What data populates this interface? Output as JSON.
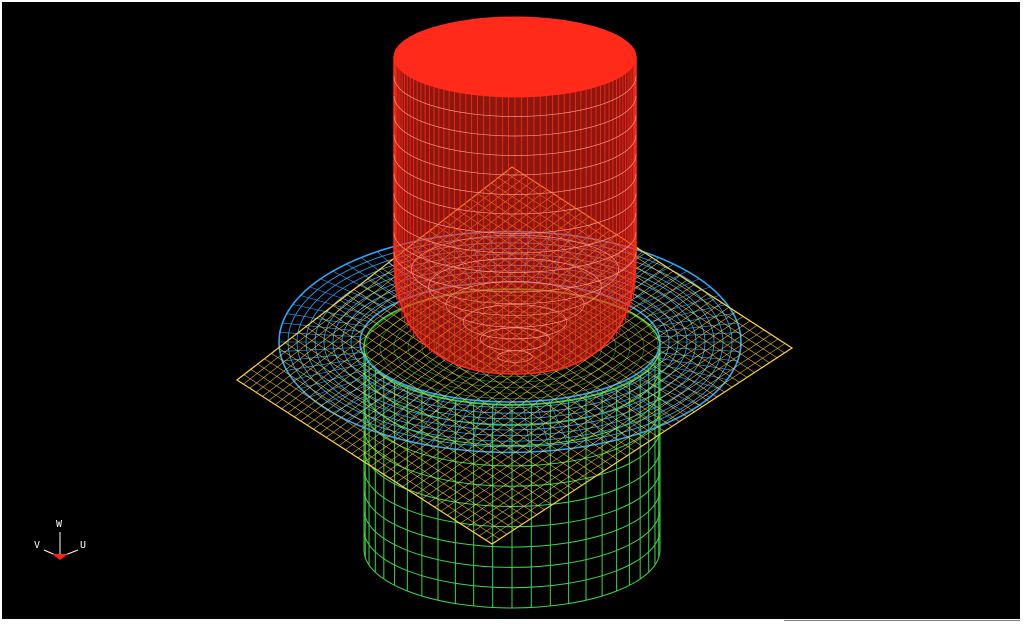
{
  "viewport": {
    "background": "#000000"
  },
  "scene": {
    "punch": {
      "color": "#ff2a1a"
    },
    "blank": {
      "color": "#ffd23a"
    },
    "holder": {
      "color": "#2aa8ff"
    },
    "die": {
      "color": "#3cd64a"
    }
  },
  "triad": {
    "w_label": "W",
    "v_label": "V",
    "u_label": "U",
    "arrow_color": "#ff2020",
    "line_color": "#ffffff"
  }
}
